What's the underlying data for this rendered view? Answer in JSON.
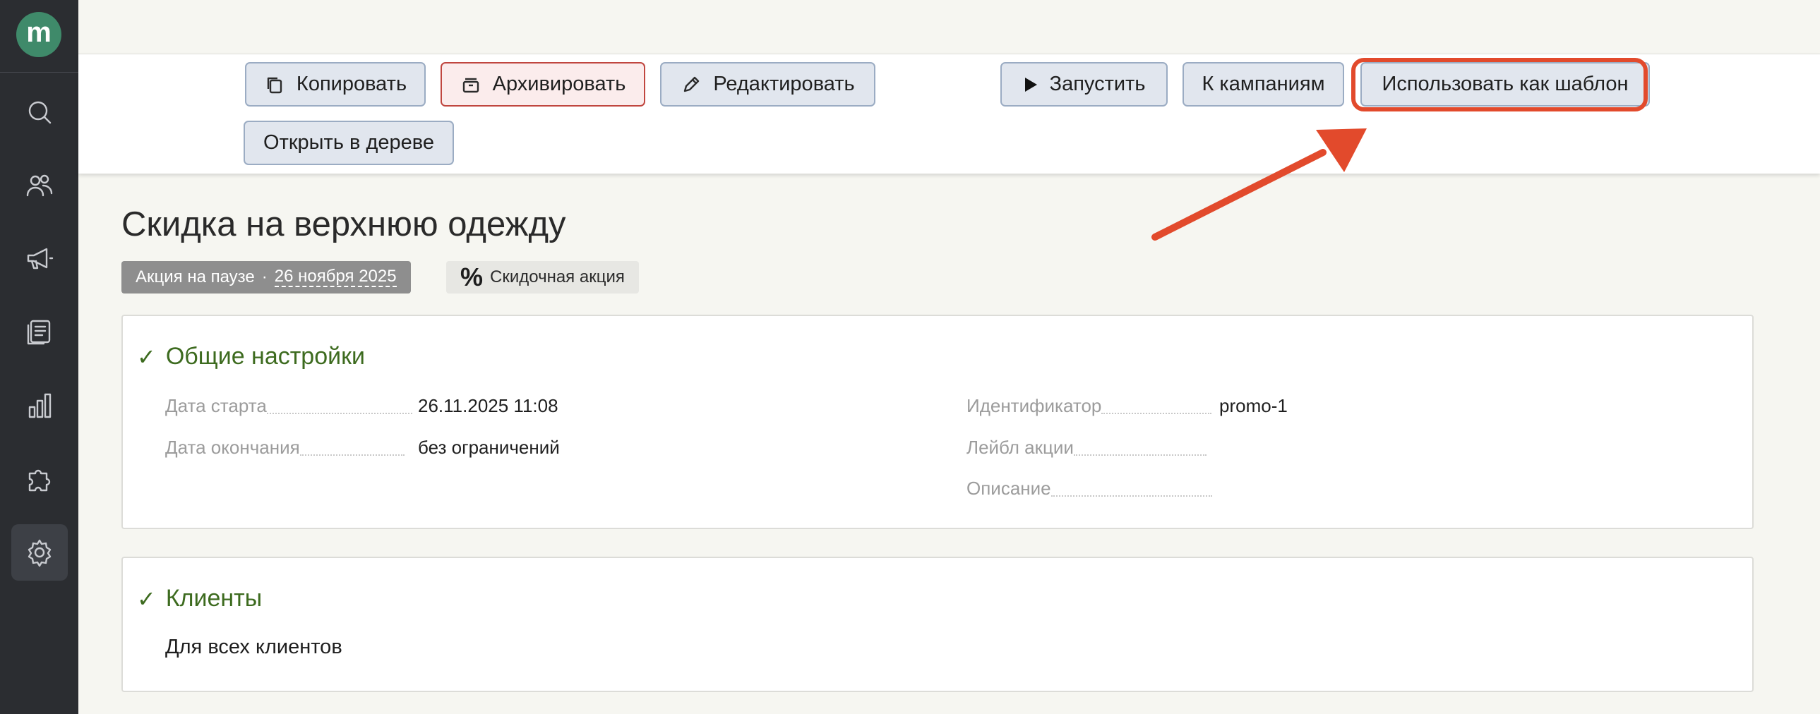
{
  "app": {
    "logo_letter": "m",
    "accent_color": "#3f8a6a"
  },
  "sidebar": {
    "items": [
      {
        "icon": "search-icon"
      },
      {
        "icon": "users-icon"
      },
      {
        "icon": "megaphone-icon"
      },
      {
        "icon": "documents-icon"
      },
      {
        "icon": "bar-chart-icon"
      },
      {
        "icon": "puzzle-icon"
      },
      {
        "icon": "gear-icon",
        "active": true
      }
    ]
  },
  "toolbar": {
    "copy_label": "Копировать",
    "archive_label": "Архивировать",
    "edit_label": "Редактировать",
    "run_label": "Запустить",
    "campaigns_label": "К кампаниям",
    "use_template_label": "Использовать как шаблон",
    "open_tree_label": "Открыть в дереве"
  },
  "promo": {
    "title": "Скидка на верхнюю одежду",
    "status_text": "Акция на паузе",
    "status_separator": "·",
    "status_date": "26 ноября 2025",
    "type_symbol": "%",
    "type_label": "Скидочная акция"
  },
  "general_settings": {
    "title": "Общие настройки",
    "check_symbol": "✓",
    "start_label": "Дата старта",
    "start_value": "26.11.2025 11:08",
    "end_label": "Дата окончания",
    "end_value": "без ограничений",
    "id_label": "Идентификатор",
    "id_value": "promo-1",
    "promo_label_label": "Лейбл акции",
    "description_label": "Описание"
  },
  "clients": {
    "title": "Клиенты",
    "check_symbol": "✓",
    "value": "Для всех клиентов"
  },
  "annotation": {
    "highlight_color": "#e24a2c"
  }
}
